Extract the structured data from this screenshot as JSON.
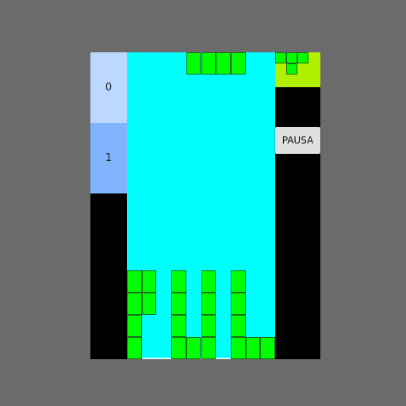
{
  "scores": {
    "box0": {
      "value": "0",
      "color": "#bdd8ff"
    },
    "box1": {
      "value": "1",
      "color": "#80b4ff"
    }
  },
  "controls": {
    "pause_label": "PAUSA"
  },
  "colors": {
    "background": "#6b6b6b",
    "board": "#00ffff",
    "block": "#00ff00",
    "block_border": "#1a6b1a",
    "next_panel": "#b0f000",
    "side_panel": "#000000"
  },
  "board": {
    "columns": 10,
    "rows": 14,
    "falling_piece": {
      "shape": "I",
      "cells": [
        [
          4,
          0
        ],
        [
          5,
          0
        ],
        [
          6,
          0
        ],
        [
          7,
          0
        ]
      ]
    },
    "stack": [
      [
        0,
        10
      ],
      [
        1,
        10
      ],
      [
        0,
        11
      ],
      [
        1,
        11
      ],
      [
        0,
        12
      ],
      [
        0,
        13
      ],
      [
        3,
        10
      ],
      [
        3,
        11
      ],
      [
        3,
        12
      ],
      [
        3,
        13
      ],
      [
        4,
        13
      ],
      [
        5,
        10
      ],
      [
        5,
        11
      ],
      [
        5,
        12
      ],
      [
        5,
        13
      ],
      [
        7,
        10
      ],
      [
        7,
        11
      ],
      [
        7,
        12
      ],
      [
        7,
        13
      ],
      [
        8,
        13
      ],
      [
        9,
        13
      ]
    ]
  },
  "next_piece": {
    "shape": "T",
    "cells": [
      [
        0,
        0
      ],
      [
        1,
        0
      ],
      [
        2,
        0
      ],
      [
        1,
        1
      ]
    ]
  }
}
